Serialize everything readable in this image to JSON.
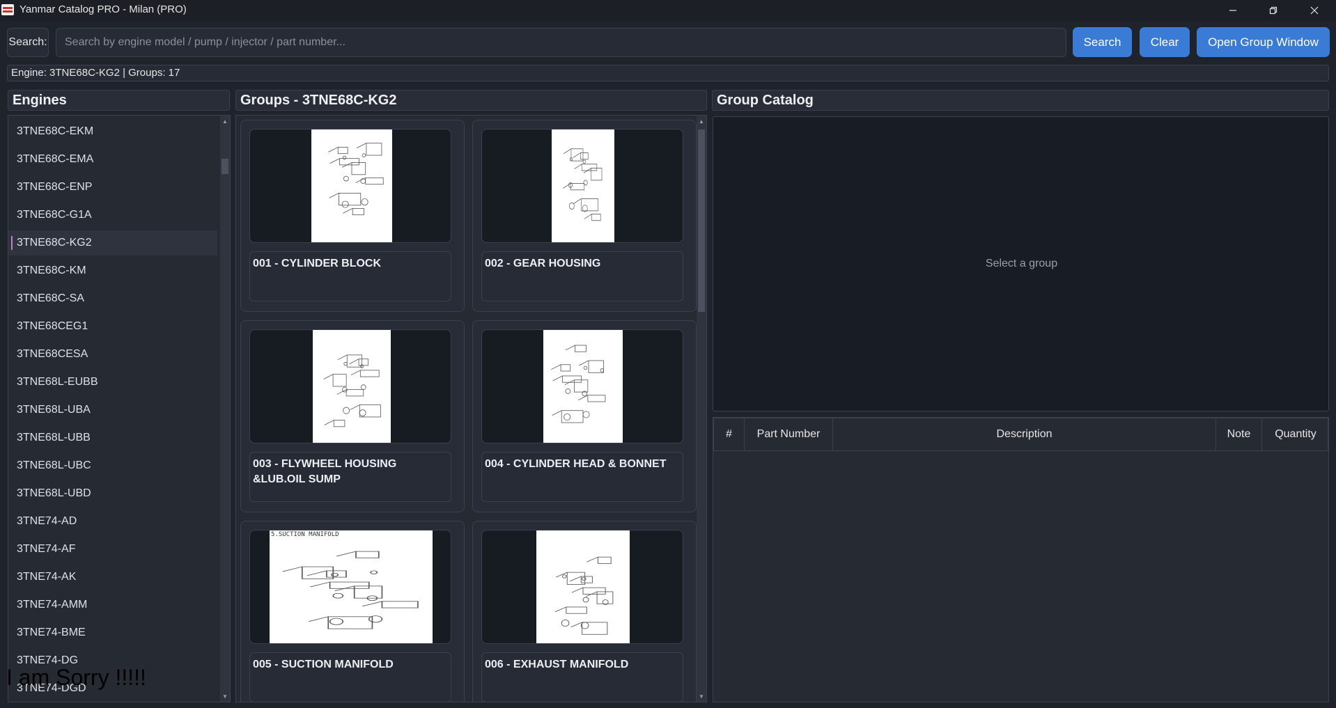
{
  "window": {
    "title": "Yanmar Catalog PRO - Milan (PRO)",
    "icons": [
      "app-icon",
      "minimize-icon",
      "restore-icon",
      "close-icon"
    ]
  },
  "search": {
    "label": "Search:",
    "placeholder": "Search by engine model / pump / injector / part number...",
    "value": "",
    "search_button": "Search",
    "clear_button": "Clear",
    "open_group_button": "Open Group Window"
  },
  "status": "Engine: 3TNE68C-KG2 | Groups: 17",
  "engines": {
    "title": "Engines",
    "selected": "3TNE68C-KG2",
    "items": [
      "3TNE68C-EKM",
      "3TNE68C-EMA",
      "3TNE68C-ENP",
      "3TNE68C-G1A",
      "3TNE68C-KG2",
      "3TNE68C-KM",
      "3TNE68C-SA",
      "3TNE68CEG1",
      "3TNE68CESA",
      "3TNE68L-EUBB",
      "3TNE68L-UBA",
      "3TNE68L-UBB",
      "3TNE68L-UBC",
      "3TNE68L-UBD",
      "3TNE74-AD",
      "3TNE74-AF",
      "3TNE74-AK",
      "3TNE74-AMM",
      "3TNE74-BME",
      "3TNE74-DG",
      "3TNE74-DGD"
    ]
  },
  "groups": {
    "title": "Groups - 3TNE68C-KG2",
    "items": [
      {
        "label": "001 - CYLINDER BLOCK",
        "thumb_text": ""
      },
      {
        "label": "002 - GEAR HOUSING",
        "thumb_text": ""
      },
      {
        "label": "003 - FLYWHEEL HOUSING &LUB.OIL SUMP",
        "thumb_text": ""
      },
      {
        "label": "004 - CYLINDER HEAD & BONNET",
        "thumb_text": ""
      },
      {
        "label": "005 - SUCTION MANIFOLD",
        "thumb_text": "5.SUCTION MANIFOLD"
      },
      {
        "label": "006 - EXHAUST MANIFOLD",
        "thumb_text": ""
      }
    ]
  },
  "catalog": {
    "title": "Group Catalog",
    "placeholder": "Select a group",
    "columns": [
      "#",
      "Part Number",
      "Description",
      "Note",
      "Quantity"
    ],
    "rows": []
  },
  "overlay_text": "I am Sorry !!!!!"
}
